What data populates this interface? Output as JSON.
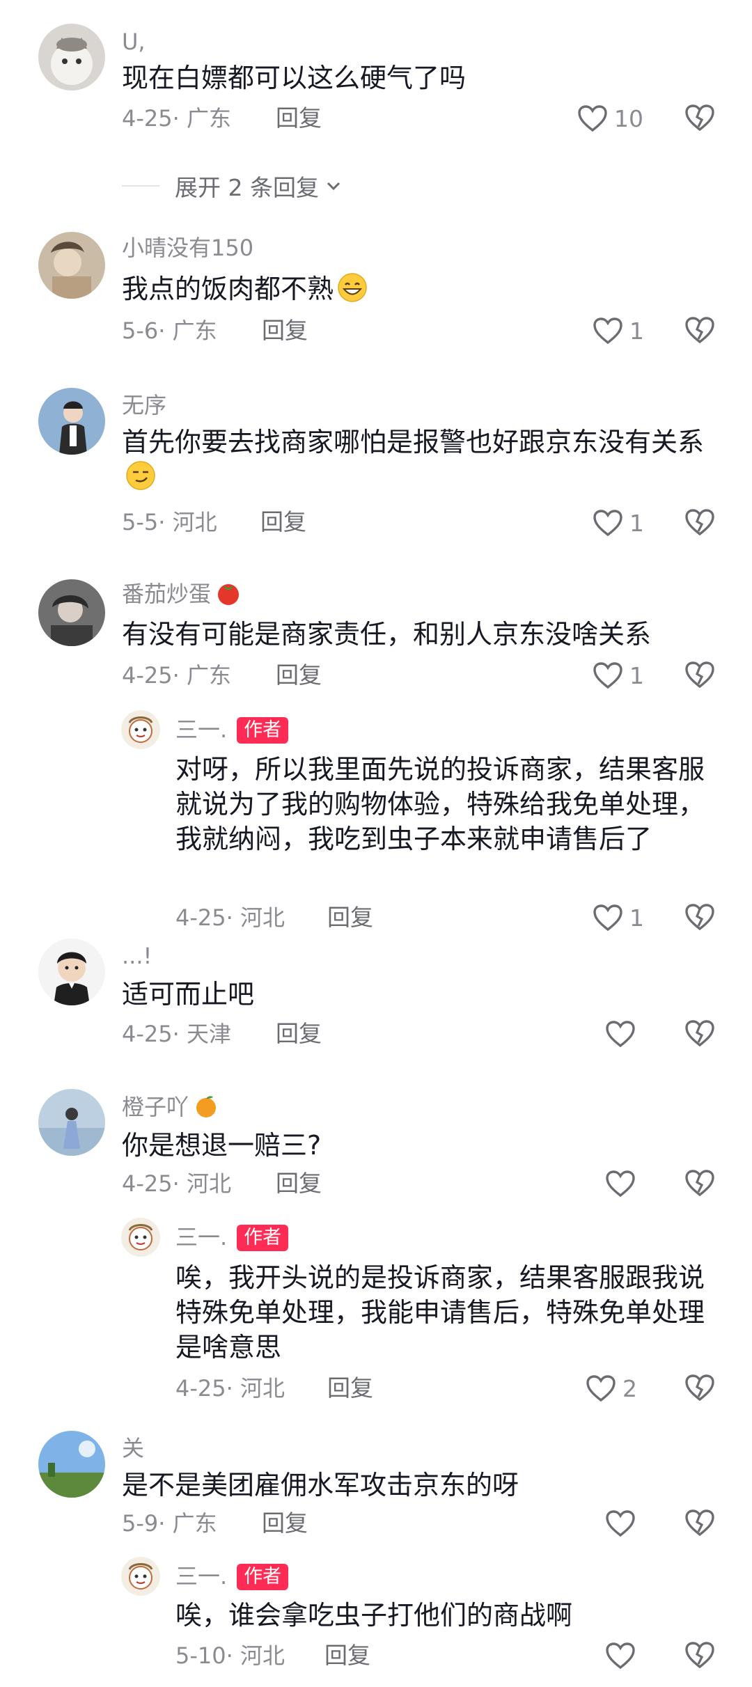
{
  "labels": {
    "reply": "回复",
    "author": "作者"
  },
  "comments": [
    {
      "name": "U,",
      "text": "现在白嫖都可以这么硬气了吗",
      "date": "4-25",
      "region": "广东",
      "likes": "10"
    },
    {
      "name": "小晴没有150",
      "text": "我点的饭肉都不熟",
      "date": "5-6",
      "region": "广东",
      "likes": "1"
    },
    {
      "name": "无序",
      "text": "首先你要去找商家哪怕是报警也好跟京东没有关系",
      "date": "5-5",
      "region": "河北",
      "likes": "1"
    },
    {
      "name": "番茄炒蛋",
      "text": "有没有可能是商家责任，和别人京东没啥关系",
      "date": "4-25",
      "region": "广东",
      "likes": "1"
    },
    {
      "name": "三一.",
      "text": "对呀，所以我里面先说的投诉商家，结果客服就说为了我的购物体验，特殊给我免单处理，我就纳闷，我吃到虫子本来就申请售后了",
      "date": "4-25",
      "region": "河北",
      "likes": "1"
    },
    {
      "name": "...!",
      "text": "适可而止吧",
      "date": "4-25",
      "region": "天津",
      "likes": ""
    },
    {
      "name": "橙子吖",
      "text": "你是想退一赔三?",
      "date": "4-25",
      "region": "河北",
      "likes": ""
    },
    {
      "name": "三一.",
      "text": "唉，我开头说的是投诉商家，结果客服跟我说特殊免单处理，我能申请售后，特殊免单处理是啥意思",
      "date": "4-25",
      "region": "河北",
      "likes": "2"
    },
    {
      "name": "关",
      "text": "是不是美团雇佣水军攻击京东的呀",
      "date": "5-9",
      "region": "广东",
      "likes": ""
    },
    {
      "name": "三一.",
      "text": "唉，谁会拿吃虫子打他们的商战啊",
      "date": "5-10",
      "region": "河北",
      "likes": ""
    }
  ],
  "expand_replies": "展开 2 条回复",
  "icons": {
    "like": "heart-outline-icon",
    "dislike": "broken-heart-icon",
    "expand": "chevron-down-icon",
    "emoji_grin": "grinning-emoji-icon",
    "emoji_smirk": "smirk-emoji-icon",
    "emoji_tomato": "tomato-emoji-icon",
    "emoji_orange": "orange-emoji-icon"
  },
  "colors": {
    "author_badge": "#fe2c55",
    "secondary_text": "#8a8b91",
    "primary_text": "#161823"
  }
}
